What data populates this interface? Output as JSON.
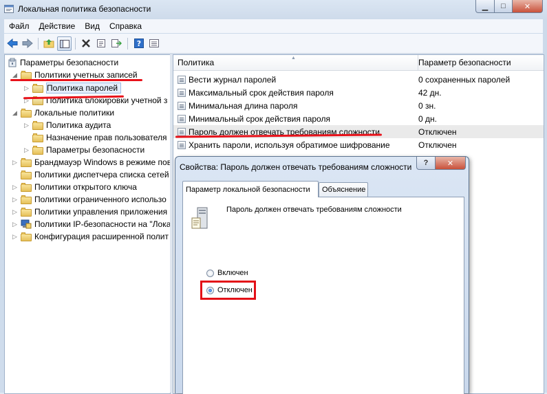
{
  "window": {
    "title": "Локальная политика безопасности",
    "minimize_glyph": "▁",
    "maximize_glyph": "□",
    "close_glyph": "✕"
  },
  "menu": [
    "Файл",
    "Действие",
    "Вид",
    "Справка"
  ],
  "toolbar_icons": [
    "back-icon",
    "forward-icon",
    "up-folder-icon",
    "show-tree-icon",
    "delete-icon",
    "properties-icon",
    "export-icon",
    "help-icon",
    "view-icon"
  ],
  "tree": {
    "root": "Параметры безопасности",
    "items": [
      {
        "label": "Политики учетных записей",
        "expander": "◢"
      },
      {
        "label": "Политика паролей",
        "expander": "▷"
      },
      {
        "label": "Политика блокировки учетной з",
        "expander": "▷"
      },
      {
        "label": "Локальные политики",
        "expander": "◢"
      },
      {
        "label": "Политика аудита",
        "expander": "▷"
      },
      {
        "label": "Назначение прав пользователя",
        "expander": ""
      },
      {
        "label": "Параметры безопасности",
        "expander": "▷"
      },
      {
        "label": "Брандмауэр Windows в режиме пов",
        "expander": "▷"
      },
      {
        "label": "Политики диспетчера списка сетей",
        "expander": ""
      },
      {
        "label": "Политики открытого ключа",
        "expander": "▷"
      },
      {
        "label": "Политики ограниченного использо",
        "expander": "▷"
      },
      {
        "label": "Политики управления приложения",
        "expander": "▷"
      },
      {
        "label": "Политики IP-безопасности на \"Лока",
        "expander": "▷"
      },
      {
        "label": "Конфигурация расширенной полит",
        "expander": "▷"
      }
    ]
  },
  "list": {
    "col_policy": "Политика",
    "col_setting": "Параметр безопасности",
    "sort_glyph": "▲",
    "rows": [
      {
        "policy": "Вести журнал паролей",
        "setting": "0 сохраненных паролей"
      },
      {
        "policy": "Максимальный срок действия пароля",
        "setting": "42 дн."
      },
      {
        "policy": "Минимальная длина пароля",
        "setting": "0 зн."
      },
      {
        "policy": "Минимальный срок действия пароля",
        "setting": "0 дн."
      },
      {
        "policy": "Пароль должен отвечать требованиям сложности",
        "setting": "Отключен"
      },
      {
        "policy": "Хранить пароли, используя обратимое шифрование",
        "setting": "Отключен"
      }
    ]
  },
  "dialog": {
    "title": "Свойства: Пароль должен отвечать требованиям сложности",
    "help_glyph": "?",
    "tabs": [
      "Параметр локальной безопасности",
      "Объяснение"
    ],
    "description": "Пароль должен отвечать требованиям сложности",
    "options": [
      {
        "label": "Включен",
        "selected": false
      },
      {
        "label": "Отключен",
        "selected": true
      }
    ]
  },
  "colors": {
    "annotation_red": "#e8121a",
    "selection": "#e5eefb"
  }
}
